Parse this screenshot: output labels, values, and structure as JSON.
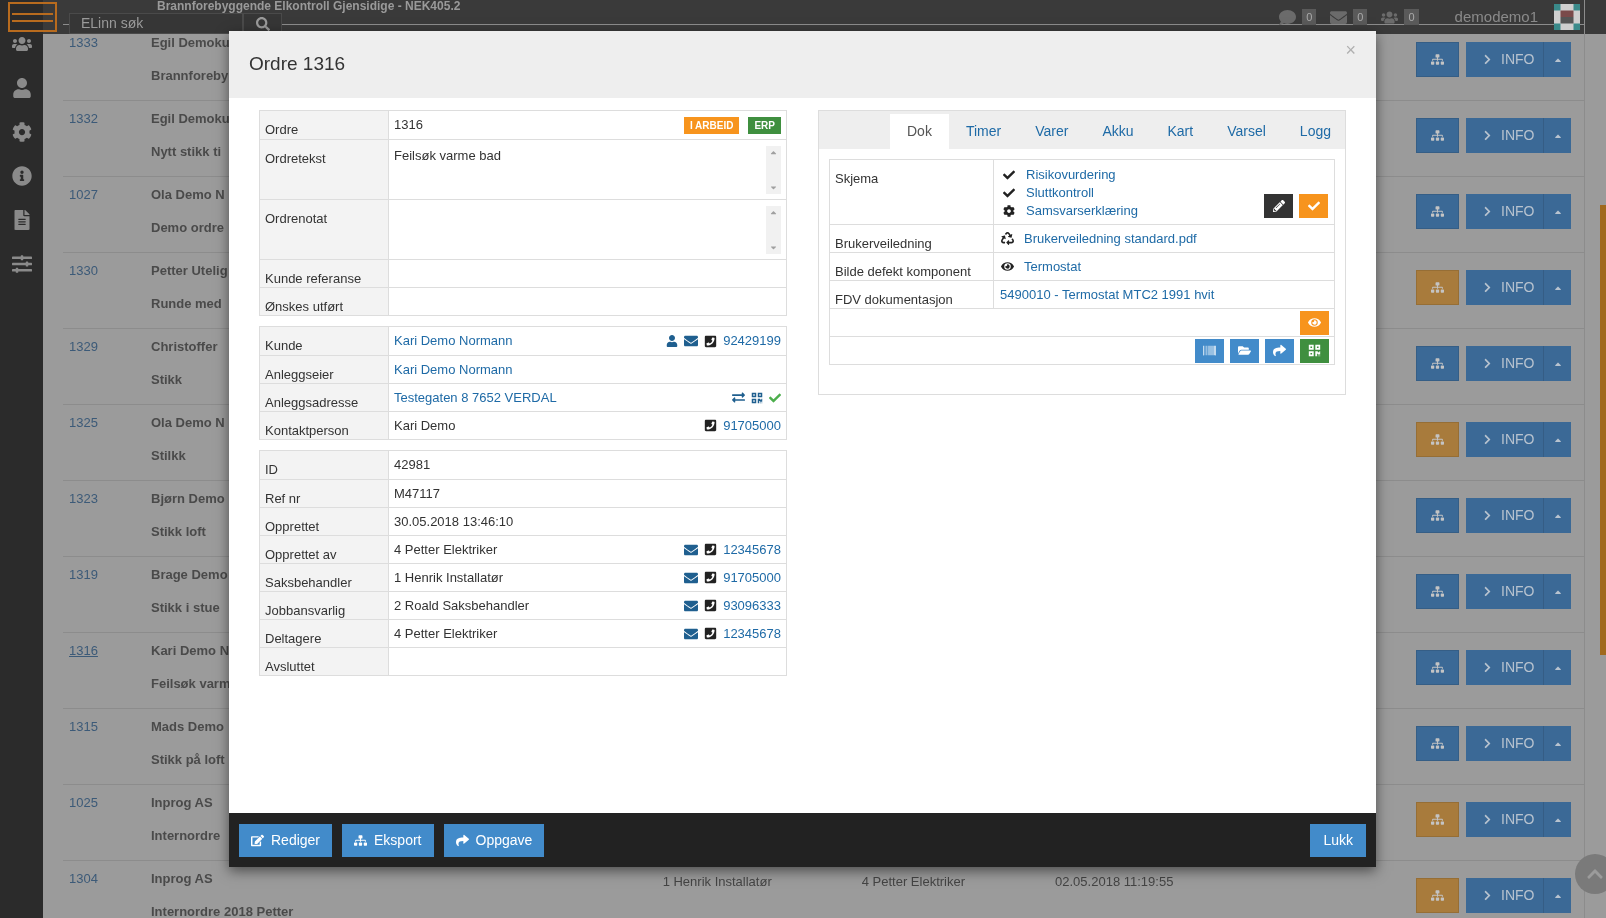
{
  "topbar": {
    "search_placeholder": "ELinn søk",
    "counters": [
      "0",
      "0",
      "0"
    ],
    "user": "demodemo1"
  },
  "list": {
    "lead_line": "Brannforebyggende Elkontroll Gjensidige - NEK405.2",
    "rows": [
      {
        "id": "1333",
        "name": "Egil Demoku",
        "subtitle": "Brannforeby",
        "selected": false,
        "color": "#3b6996",
        "info": "INFO"
      },
      {
        "id": "1332",
        "name": "Egil Demoku",
        "subtitle": "Nytt stikk ti",
        "selected": false,
        "color": "#3b6996",
        "info": "INFO"
      },
      {
        "id": "1027",
        "name": "Ola Demo N",
        "subtitle": "Demo ordre",
        "selected": false,
        "color": "#3b6996",
        "info": "INFO"
      },
      {
        "id": "1330",
        "name": "Petter Utelig",
        "subtitle": "Runde med",
        "selected": false,
        "color": "#a87b3c",
        "info": "INFO"
      },
      {
        "id": "1329",
        "name": "Christoffer",
        "subtitle": "Stikk",
        "selected": false,
        "color": "#3b6996",
        "info": "INFO"
      },
      {
        "id": "1325",
        "name": "Ola Demo N",
        "subtitle": "Stilkk",
        "selected": false,
        "color": "#a87b3c",
        "info": "INFO"
      },
      {
        "id": "1323",
        "name": "Bjørn Demo",
        "subtitle": "Stikk loft",
        "selected": false,
        "color": "#3b6996",
        "info": "INFO"
      },
      {
        "id": "1319",
        "name": "Brage Demo",
        "subtitle": "Stikk i stue",
        "selected": false,
        "color": "#3b6996",
        "info": "INFO"
      },
      {
        "id": "1316",
        "name": "Kari Demo N",
        "subtitle": "Feilsøk varm",
        "selected": true,
        "color": "#3b6996",
        "info": "INFO"
      },
      {
        "id": "1315",
        "name": "Mads Demo",
        "subtitle": "Stikk på loft",
        "selected": false,
        "color": "#3b6996",
        "info": "INFO"
      },
      {
        "id": "1025",
        "name": "Inprog AS",
        "subtitle": "Internordre",
        "selected": false,
        "color": "#a87b3c",
        "info": "INFO"
      },
      {
        "id": "1304",
        "name": "Inprog AS",
        "subtitle": "Internordre 2018 Petter",
        "selected": false,
        "color": "#a87b3c",
        "info": "INFO",
        "columns": [
          "1 Henrik Installatør",
          "4 Petter Elektriker",
          "02.05.2018 11:19:55"
        ]
      }
    ]
  },
  "modal": {
    "title": "Ordre 1316",
    "close": "×",
    "groups": [
      [
        {
          "kind": "plain",
          "label": "Ordre",
          "value": "1316",
          "badges": [
            {
              "text": "I ARBEID",
              "color": "#f7941d"
            },
            {
              "text": "ERP",
              "color": "#3f8f3f"
            }
          ]
        },
        {
          "kind": "textarea",
          "label": "Ordretekst",
          "value": "Feilsøk varme bad"
        },
        {
          "kind": "textarea",
          "label": "Ordrenotat"
        },
        {
          "kind": "plain",
          "label": "Kunde referanse"
        },
        {
          "kind": "plain",
          "label": "Ønskes utført"
        }
      ],
      [
        {
          "kind": "customer",
          "label": "Kunde",
          "link": "Kari Demo Normann",
          "phone": "92429199"
        },
        {
          "kind": "link",
          "label": "Anleggseier",
          "link": "Kari Demo Normann"
        },
        {
          "kind": "address",
          "label": "Anleggsadresse",
          "link": "Testegaten 8 7652 VERDAL"
        },
        {
          "kind": "contact",
          "label": "Kontaktperson",
          "value": "Kari Demo",
          "phone": "91705000"
        }
      ],
      [
        {
          "kind": "plain",
          "label": "ID",
          "value": "42981"
        },
        {
          "kind": "plain",
          "label": "Ref nr",
          "value": "M47117"
        },
        {
          "kind": "plain",
          "label": "Opprettet",
          "value": "30.05.2018 13:46:10"
        },
        {
          "kind": "staff",
          "label": "Opprettet av",
          "value": "4 Petter Elektriker",
          "phone": "12345678"
        },
        {
          "kind": "staff",
          "label": "Saksbehandler",
          "value": "1 Henrik Installatør",
          "phone": "91705000"
        },
        {
          "kind": "staff",
          "label": "Jobbansvarlig",
          "value": "2 Roald Saksbehandler",
          "phone": "93096333"
        },
        {
          "kind": "staff",
          "label": "Deltagere",
          "value": "4 Petter Elektriker",
          "phone": "12345678"
        },
        {
          "kind": "plain",
          "label": "Avsluttet"
        }
      ]
    ],
    "tabs": [
      {
        "label": "Dok",
        "selected": true
      },
      {
        "label": "Timer",
        "selected": false
      },
      {
        "label": "Varer",
        "selected": false
      },
      {
        "label": "Akku",
        "selected": false
      },
      {
        "label": "Kart",
        "selected": false
      },
      {
        "label": "Varsel",
        "selected": false
      },
      {
        "label": "Logg",
        "selected": false
      }
    ],
    "docs": [
      {
        "label": "Skjema",
        "kind": "forms",
        "items": [
          {
            "text": "Risikovurdering",
            "kind": "done"
          },
          {
            "text": "Sluttkontroll",
            "kind": "done"
          },
          {
            "text": "Samsvarserklæring",
            "kind": "pending"
          }
        ]
      },
      {
        "label": "Brukerveiledning",
        "kind": "recycle",
        "link": "Brukerveiledning standard.pdf"
      },
      {
        "label": "Bilde defekt komponent",
        "kind": "eye",
        "link": "Termostat"
      },
      {
        "label": "FDV dokumentasjon",
        "kind": "plain",
        "link": "5490010 - Termostat MTC2 1991 hvit"
      }
    ],
    "footer_left": [
      "Rediger",
      "Eksport",
      "Oppgave"
    ],
    "footer_right": "Lukk"
  }
}
